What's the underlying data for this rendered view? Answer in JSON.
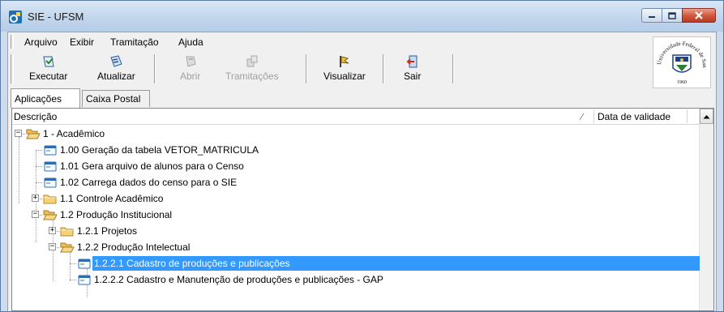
{
  "window": {
    "title": "SIE - UFSM",
    "colors": {
      "titlebar": "#c2d6ec",
      "close_button": "#d35a3e",
      "selection": "#3399ff"
    }
  },
  "menu": [
    {
      "label": "Arquivo"
    },
    {
      "label": "Exibir"
    },
    {
      "label": "Tramitação"
    },
    {
      "label": "Ajuda"
    }
  ],
  "toolbar": [
    {
      "label": "Executar",
      "icon": "execute-icon",
      "enabled": true
    },
    {
      "label": "Atualizar",
      "icon": "refresh-icon",
      "enabled": true
    },
    {
      "label": "Abrir",
      "icon": "open-icon",
      "enabled": false
    },
    {
      "label": "Tramitações",
      "icon": "tramitacoes-icon",
      "enabled": false
    },
    {
      "label": "Visualizar",
      "icon": "view-icon",
      "enabled": true
    },
    {
      "label": "Sair",
      "icon": "exit-icon",
      "enabled": true
    }
  ],
  "logo": {
    "text": "Universidade Federal de Santa Maria",
    "year": "1960"
  },
  "tabs": [
    {
      "label": "Aplicações",
      "active": true
    },
    {
      "label": "Caixa Postal",
      "active": false
    }
  ],
  "list": {
    "columns": [
      {
        "label": "Descrição"
      },
      {
        "label": "Data de validade"
      }
    ],
    "sort_indicator": "∕",
    "rows": [
      {
        "label": "1 - Acadêmico",
        "type": "folder-open",
        "expander": "−"
      },
      {
        "label": "1.00 Geração da tabela VETOR_MATRICULA",
        "type": "app"
      },
      {
        "label": "1.01 Gera arquivo de alunos para o Censo",
        "type": "app"
      },
      {
        "label": "1.02 Carrega dados do censo para o SIE",
        "type": "app"
      },
      {
        "label": "1.1 Controle Acadêmico",
        "type": "folder",
        "expander": "+"
      },
      {
        "label": "1.2 Produção Institucional",
        "type": "folder-open",
        "expander": "−"
      },
      {
        "label": "1.2.1 Projetos",
        "type": "folder",
        "expander": "+"
      },
      {
        "label": "1.2.2 Produção Intelectual",
        "type": "folder-open",
        "expander": "−"
      },
      {
        "label": "1.2.2.1 Cadastro de produções e publicações",
        "type": "app",
        "selected": true
      },
      {
        "label": "1.2.2.2 Cadastro e Manutenção de produções e publicações - GAP",
        "type": "app"
      }
    ]
  }
}
